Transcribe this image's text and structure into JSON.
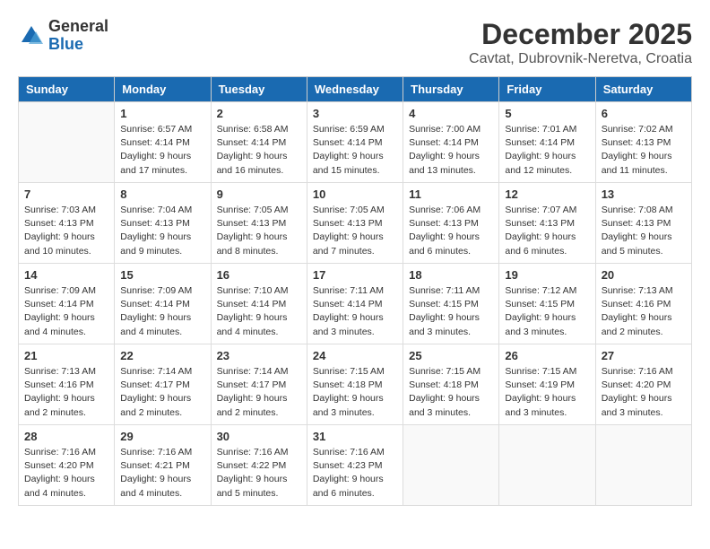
{
  "logo": {
    "general": "General",
    "blue": "Blue"
  },
  "title": "December 2025",
  "location": "Cavtat, Dubrovnik-Neretva, Croatia",
  "weekdays": [
    "Sunday",
    "Monday",
    "Tuesday",
    "Wednesday",
    "Thursday",
    "Friday",
    "Saturday"
  ],
  "weeks": [
    [
      {
        "day": "",
        "info": ""
      },
      {
        "day": "1",
        "info": "Sunrise: 6:57 AM\nSunset: 4:14 PM\nDaylight: 9 hours\nand 17 minutes."
      },
      {
        "day": "2",
        "info": "Sunrise: 6:58 AM\nSunset: 4:14 PM\nDaylight: 9 hours\nand 16 minutes."
      },
      {
        "day": "3",
        "info": "Sunrise: 6:59 AM\nSunset: 4:14 PM\nDaylight: 9 hours\nand 15 minutes."
      },
      {
        "day": "4",
        "info": "Sunrise: 7:00 AM\nSunset: 4:14 PM\nDaylight: 9 hours\nand 13 minutes."
      },
      {
        "day": "5",
        "info": "Sunrise: 7:01 AM\nSunset: 4:14 PM\nDaylight: 9 hours\nand 12 minutes."
      },
      {
        "day": "6",
        "info": "Sunrise: 7:02 AM\nSunset: 4:13 PM\nDaylight: 9 hours\nand 11 minutes."
      }
    ],
    [
      {
        "day": "7",
        "info": "Sunrise: 7:03 AM\nSunset: 4:13 PM\nDaylight: 9 hours\nand 10 minutes."
      },
      {
        "day": "8",
        "info": "Sunrise: 7:04 AM\nSunset: 4:13 PM\nDaylight: 9 hours\nand 9 minutes."
      },
      {
        "day": "9",
        "info": "Sunrise: 7:05 AM\nSunset: 4:13 PM\nDaylight: 9 hours\nand 8 minutes."
      },
      {
        "day": "10",
        "info": "Sunrise: 7:05 AM\nSunset: 4:13 PM\nDaylight: 9 hours\nand 7 minutes."
      },
      {
        "day": "11",
        "info": "Sunrise: 7:06 AM\nSunset: 4:13 PM\nDaylight: 9 hours\nand 6 minutes."
      },
      {
        "day": "12",
        "info": "Sunrise: 7:07 AM\nSunset: 4:13 PM\nDaylight: 9 hours\nand 6 minutes."
      },
      {
        "day": "13",
        "info": "Sunrise: 7:08 AM\nSunset: 4:13 PM\nDaylight: 9 hours\nand 5 minutes."
      }
    ],
    [
      {
        "day": "14",
        "info": "Sunrise: 7:09 AM\nSunset: 4:14 PM\nDaylight: 9 hours\nand 4 minutes."
      },
      {
        "day": "15",
        "info": "Sunrise: 7:09 AM\nSunset: 4:14 PM\nDaylight: 9 hours\nand 4 minutes."
      },
      {
        "day": "16",
        "info": "Sunrise: 7:10 AM\nSunset: 4:14 PM\nDaylight: 9 hours\nand 4 minutes."
      },
      {
        "day": "17",
        "info": "Sunrise: 7:11 AM\nSunset: 4:14 PM\nDaylight: 9 hours\nand 3 minutes."
      },
      {
        "day": "18",
        "info": "Sunrise: 7:11 AM\nSunset: 4:15 PM\nDaylight: 9 hours\nand 3 minutes."
      },
      {
        "day": "19",
        "info": "Sunrise: 7:12 AM\nSunset: 4:15 PM\nDaylight: 9 hours\nand 3 minutes."
      },
      {
        "day": "20",
        "info": "Sunrise: 7:13 AM\nSunset: 4:16 PM\nDaylight: 9 hours\nand 2 minutes."
      }
    ],
    [
      {
        "day": "21",
        "info": "Sunrise: 7:13 AM\nSunset: 4:16 PM\nDaylight: 9 hours\nand 2 minutes."
      },
      {
        "day": "22",
        "info": "Sunrise: 7:14 AM\nSunset: 4:17 PM\nDaylight: 9 hours\nand 2 minutes."
      },
      {
        "day": "23",
        "info": "Sunrise: 7:14 AM\nSunset: 4:17 PM\nDaylight: 9 hours\nand 2 minutes."
      },
      {
        "day": "24",
        "info": "Sunrise: 7:15 AM\nSunset: 4:18 PM\nDaylight: 9 hours\nand 3 minutes."
      },
      {
        "day": "25",
        "info": "Sunrise: 7:15 AM\nSunset: 4:18 PM\nDaylight: 9 hours\nand 3 minutes."
      },
      {
        "day": "26",
        "info": "Sunrise: 7:15 AM\nSunset: 4:19 PM\nDaylight: 9 hours\nand 3 minutes."
      },
      {
        "day": "27",
        "info": "Sunrise: 7:16 AM\nSunset: 4:20 PM\nDaylight: 9 hours\nand 3 minutes."
      }
    ],
    [
      {
        "day": "28",
        "info": "Sunrise: 7:16 AM\nSunset: 4:20 PM\nDaylight: 9 hours\nand 4 minutes."
      },
      {
        "day": "29",
        "info": "Sunrise: 7:16 AM\nSunset: 4:21 PM\nDaylight: 9 hours\nand 4 minutes."
      },
      {
        "day": "30",
        "info": "Sunrise: 7:16 AM\nSunset: 4:22 PM\nDaylight: 9 hours\nand 5 minutes."
      },
      {
        "day": "31",
        "info": "Sunrise: 7:16 AM\nSunset: 4:23 PM\nDaylight: 9 hours\nand 6 minutes."
      },
      {
        "day": "",
        "info": ""
      },
      {
        "day": "",
        "info": ""
      },
      {
        "day": "",
        "info": ""
      }
    ]
  ]
}
